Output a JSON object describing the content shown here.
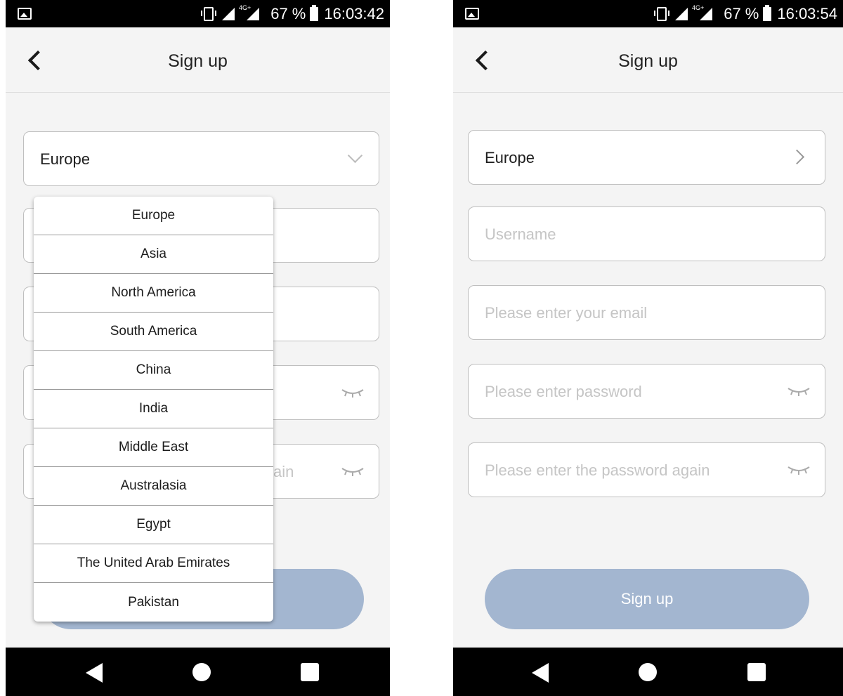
{
  "left_screen": {
    "status_bar": {
      "battery": "67 %",
      "time": "16:03:42",
      "network": "4G+"
    },
    "header": {
      "title": "Sign up"
    },
    "region_select": {
      "value": "Europe"
    },
    "partial_password_again_tail": "ain",
    "dropdown": {
      "options": [
        "Europe",
        "Asia",
        "North America",
        "South America",
        "China",
        "India",
        "Middle East",
        "Australasia",
        "Egypt",
        "The United Arab Emirates",
        "Pakistan"
      ]
    }
  },
  "right_screen": {
    "status_bar": {
      "battery": "67 %",
      "time": "16:03:54",
      "network": "4G+"
    },
    "header": {
      "title": "Sign up"
    },
    "region_select": {
      "value": "Europe"
    },
    "form": {
      "username_placeholder": "Username",
      "email_placeholder": "Please enter your email",
      "password_placeholder": "Please enter password",
      "password_again_placeholder": "Please enter the password again"
    },
    "signup_button": "Sign up"
  },
  "colors": {
    "background": "#f4f4f4",
    "button": "#a3b6d0",
    "border": "#bfbfbf",
    "placeholder": "#c5c5c5"
  },
  "icons": [
    "back-chevron-icon",
    "chevron-down-icon",
    "chevron-right-icon",
    "eye-closed-icon",
    "nav-back-icon",
    "nav-home-icon",
    "nav-recents-icon"
  ]
}
